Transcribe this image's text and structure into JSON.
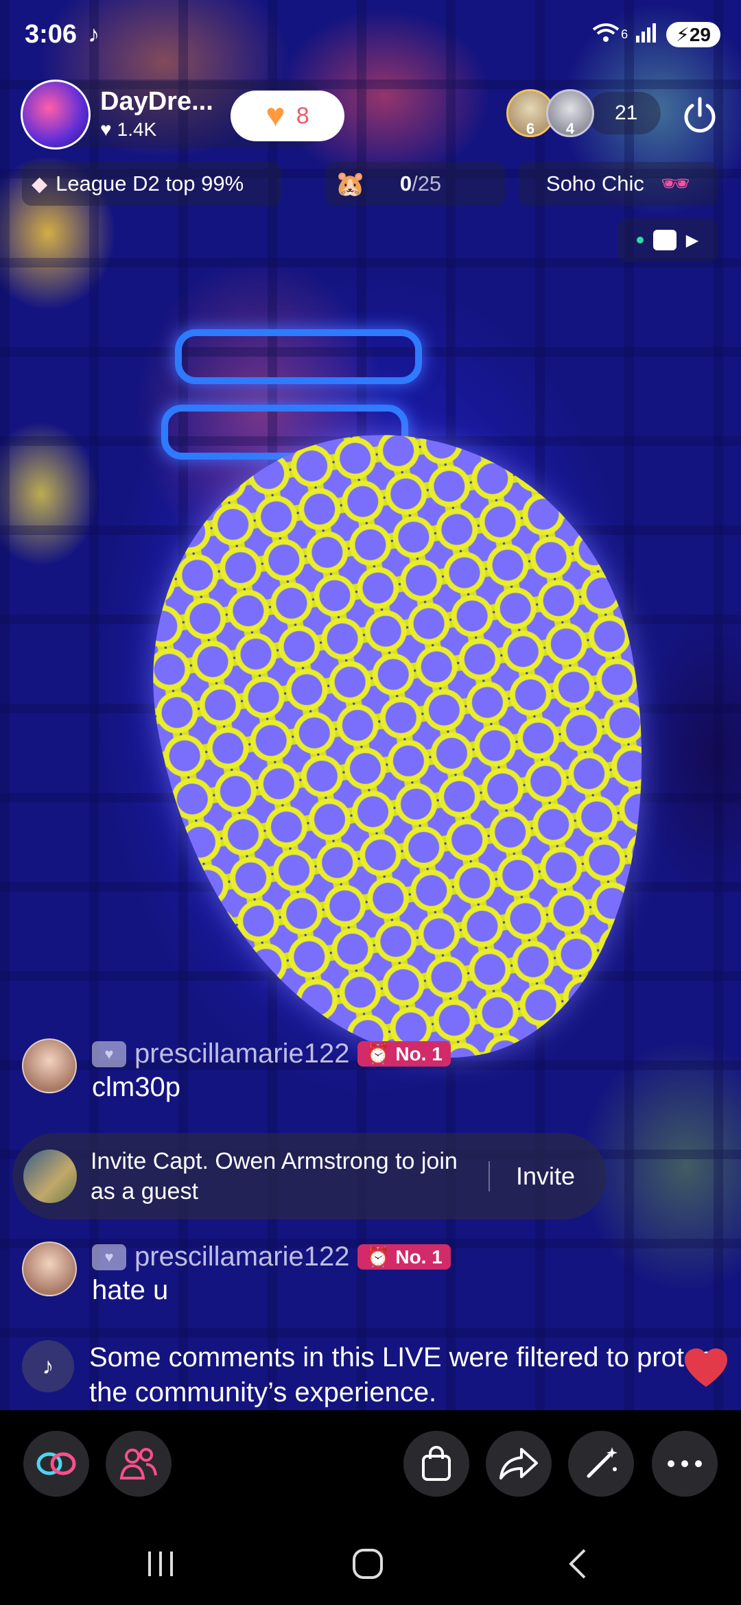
{
  "status_bar": {
    "time": "3:06",
    "wifi_label": "6",
    "battery": "29"
  },
  "host": {
    "name": "DayDre...",
    "likes": "1.4K",
    "follow_count": "8"
  },
  "viewers": {
    "avatar1_badge": "6",
    "avatar2_badge": "4",
    "count": "21"
  },
  "chips": {
    "league": "League D2 top 99%",
    "goal_count": "0",
    "goal_total": "/25",
    "soho": "Soho Chic"
  },
  "comments": [
    {
      "user": "prescillamarie122",
      "badge": "No. 1",
      "text": "clm30p"
    },
    {
      "user": "prescillamarie122",
      "badge": "No. 1",
      "text": "hate u"
    }
  ],
  "invite": {
    "text": "Invite Capt. Owen Armstrong to join as a guest",
    "button": "Invite"
  },
  "system_message": "Some comments in this LIVE were filtered to protect the community’s experience.",
  "colors": {
    "accent_pink": "#f05a64",
    "badge": "#d12b6a",
    "toolbar_bg": "#2a2a2e"
  },
  "toolbar_icons": [
    "link-icon",
    "guests-icon",
    "shopping-bag-icon",
    "share-icon",
    "magic-wand-icon",
    "more-icon"
  ],
  "nav_icons": [
    "recents-icon",
    "home-icon",
    "back-icon"
  ]
}
